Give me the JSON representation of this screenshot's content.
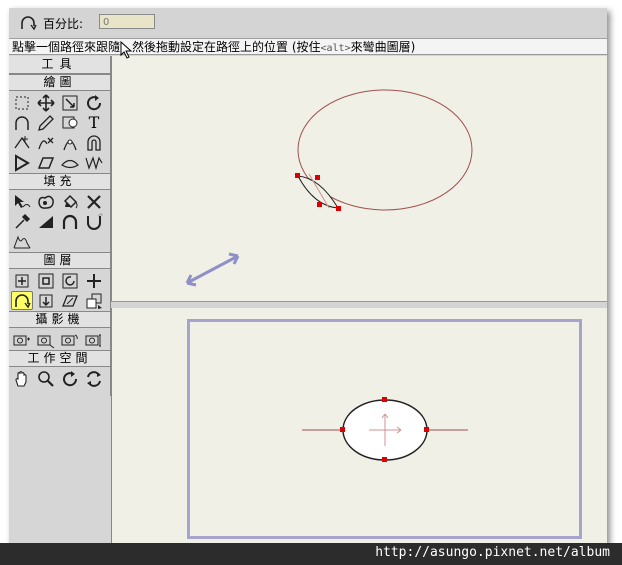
{
  "tool_options": {
    "percent_label": "百分比:",
    "percent_value": "0"
  },
  "status": {
    "before_key": "點擊一個路徑來跟隨，然後拖動設定在路徑上的位置 (按住",
    "key": "<alt>",
    "after_key": "來彎曲圖層)"
  },
  "toolbox": {
    "title": "工具",
    "sections": {
      "draw": "繪圖",
      "fill": "填充",
      "layer": "圖層",
      "camera": "攝影機",
      "workspace": "工作空間"
    },
    "text_tool_glyph": "T",
    "selected_tool": "path-follow"
  },
  "colors": {
    "highlight": "#ffff66",
    "canvas": "#f0f0e6",
    "control_point": "#dd0000",
    "camera_frame": "#a4a4cc",
    "arrow": "#9090c8"
  },
  "watermark": {
    "text": "http://asungo.pixnet.net/album"
  }
}
